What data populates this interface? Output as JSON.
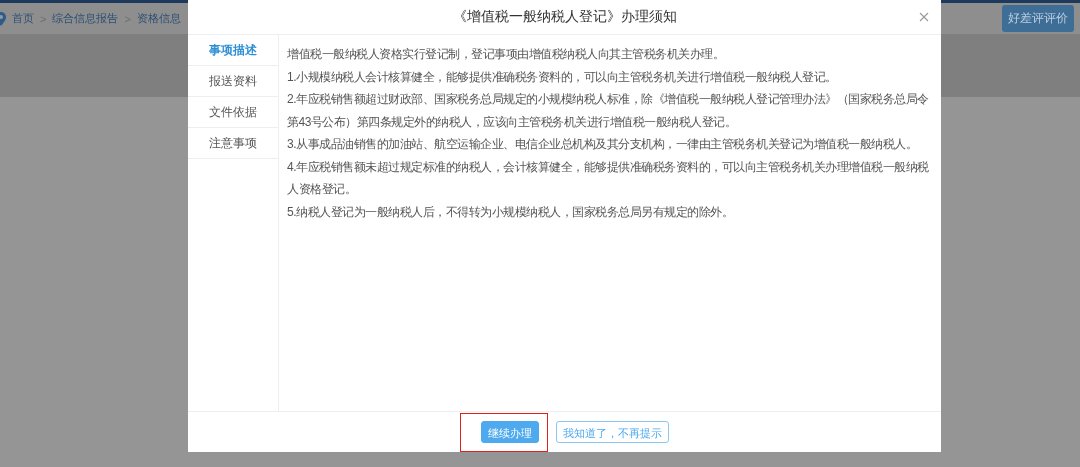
{
  "breadcrumb": [
    {
      "label": "首页"
    },
    {
      "label": "综合信息报告"
    },
    {
      "label": "资格信息"
    }
  ],
  "breadcrumb_separator": ">",
  "rating_button": "好差评评价",
  "dialog": {
    "title": "《增值税一般纳税人登记》办理须知",
    "tabs": [
      {
        "label": "事项描述",
        "selected": true
      },
      {
        "label": "报送资料",
        "selected": false
      },
      {
        "label": "文件依据",
        "selected": false
      },
      {
        "label": "注意事项",
        "selected": false
      }
    ],
    "paragraphs": [
      "增值税一般纳税人资格实行登记制，登记事项由增值税纳税人向其主管税务机关办理。",
      "1.小规模纳税人会计核算健全，能够提供准确税务资料的，可以向主管税务机关进行增值税一般纳税人登记。",
      "2.年应税销售额超过财政部、国家税务总局规定的小规模纳税人标准，除《增值税一般纳税人登记管理办法》（国家税务总局令第43号公布）第四条规定外的纳税人，应该向主管税务机关进行增值税一般纳税人登记。",
      "3.从事成品油销售的加油站、航空运输企业、电信企业总机构及其分支机构，一律由主管税务机关登记为增值税一般纳税人。",
      "4.年应税销售额未超过规定标准的纳税人，会计核算健全，能够提供准确税务资料的，可以向主管税务机关办理增值税一般纳税人资格登记。",
      "5.纳税人登记为一般纳税人后，不得转为小规模纳税人，国家税务总局另有规定的除外。"
    ],
    "buttons": [
      {
        "label": "继续办理",
        "kind": "primary",
        "highlighted": true
      },
      {
        "label": "我知道了，不再提示",
        "kind": "secondary",
        "highlighted": false
      }
    ]
  }
}
